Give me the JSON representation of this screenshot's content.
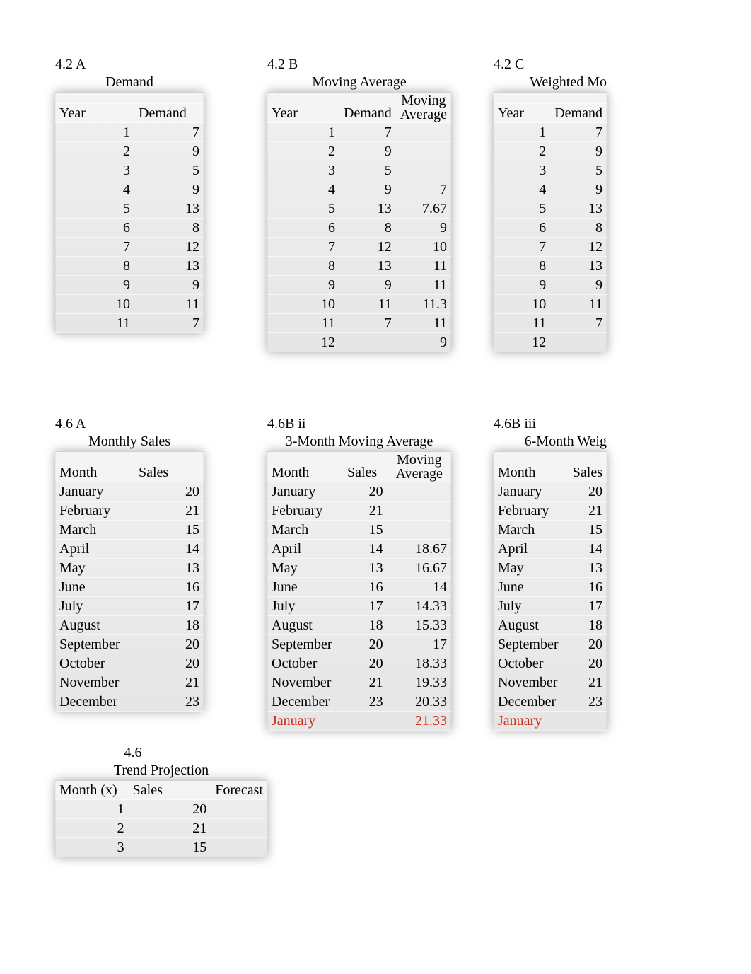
{
  "table42A": {
    "heading": "4.2 A",
    "title": "Demand",
    "cols": [
      "Year",
      "Demand"
    ],
    "rows": [
      {
        "year": "1",
        "demand": "7"
      },
      {
        "year": "2",
        "demand": "9"
      },
      {
        "year": "3",
        "demand": "5"
      },
      {
        "year": "4",
        "demand": "9"
      },
      {
        "year": "5",
        "demand": "13"
      },
      {
        "year": "6",
        "demand": "8"
      },
      {
        "year": "7",
        "demand": "12"
      },
      {
        "year": "8",
        "demand": "13"
      },
      {
        "year": "9",
        "demand": "9"
      },
      {
        "year": "10",
        "demand": "11"
      },
      {
        "year": "11",
        "demand": "7"
      }
    ]
  },
  "table42B": {
    "heading": "4.2 B",
    "title": "Moving Average",
    "cols": [
      "Year",
      "Demand",
      "Moving Average"
    ],
    "rows": [
      {
        "year": "1",
        "demand": "7",
        "ma": ""
      },
      {
        "year": "2",
        "demand": "9",
        "ma": ""
      },
      {
        "year": "3",
        "demand": "5",
        "ma": ""
      },
      {
        "year": "4",
        "demand": "9",
        "ma": "7"
      },
      {
        "year": "5",
        "demand": "13",
        "ma": "7.67"
      },
      {
        "year": "6",
        "demand": "8",
        "ma": "9"
      },
      {
        "year": "7",
        "demand": "12",
        "ma": "10"
      },
      {
        "year": "8",
        "demand": "13",
        "ma": "11"
      },
      {
        "year": "9",
        "demand": "9",
        "ma": "11"
      },
      {
        "year": "10",
        "demand": "11",
        "ma": "11.3"
      },
      {
        "year": "11",
        "demand": "7",
        "ma": "11"
      },
      {
        "year": "12",
        "demand": "",
        "ma": "9"
      }
    ]
  },
  "table42C": {
    "heading": "4.2 C",
    "title": "Weighted Mo",
    "cols": [
      "Year",
      "Demand"
    ],
    "rows": [
      {
        "year": "1",
        "demand": "7"
      },
      {
        "year": "2",
        "demand": "9"
      },
      {
        "year": "3",
        "demand": "5"
      },
      {
        "year": "4",
        "demand": "9"
      },
      {
        "year": "5",
        "demand": "13"
      },
      {
        "year": "6",
        "demand": "8"
      },
      {
        "year": "7",
        "demand": "12"
      },
      {
        "year": "8",
        "demand": "13"
      },
      {
        "year": "9",
        "demand": "9"
      },
      {
        "year": "10",
        "demand": "11"
      },
      {
        "year": "11",
        "demand": "7"
      },
      {
        "year": "12",
        "demand": ""
      }
    ]
  },
  "table46A": {
    "heading": "4.6 A",
    "title": "Monthly Sales",
    "cols": [
      "Month",
      "Sales"
    ],
    "rows": [
      {
        "month": "January",
        "sales": "20"
      },
      {
        "month": "February",
        "sales": "21"
      },
      {
        "month": "March",
        "sales": "15"
      },
      {
        "month": "April",
        "sales": "14"
      },
      {
        "month": "May",
        "sales": "13"
      },
      {
        "month": "June",
        "sales": "16"
      },
      {
        "month": "July",
        "sales": "17"
      },
      {
        "month": "August",
        "sales": "18"
      },
      {
        "month": "September",
        "sales": "20"
      },
      {
        "month": "October",
        "sales": "20"
      },
      {
        "month": "November",
        "sales": "21"
      },
      {
        "month": "December",
        "sales": "23"
      }
    ]
  },
  "table46Bii": {
    "heading": "4.6B ii",
    "title": "3-Month Moving Average",
    "cols": [
      "Month",
      "Sales",
      "Moving Average"
    ],
    "rows": [
      {
        "month": "January",
        "sales": "20",
        "ma": "",
        "red": false
      },
      {
        "month": "February",
        "sales": "21",
        "ma": "",
        "red": false
      },
      {
        "month": "March",
        "sales": "15",
        "ma": "",
        "red": false
      },
      {
        "month": "April",
        "sales": "14",
        "ma": "18.67",
        "red": false
      },
      {
        "month": "May",
        "sales": "13",
        "ma": "16.67",
        "red": false
      },
      {
        "month": "June",
        "sales": "16",
        "ma": "14",
        "red": false
      },
      {
        "month": "July",
        "sales": "17",
        "ma": "14.33",
        "red": false
      },
      {
        "month": "August",
        "sales": "18",
        "ma": "15.33",
        "red": false
      },
      {
        "month": "September",
        "sales": "20",
        "ma": "17",
        "red": false
      },
      {
        "month": "October",
        "sales": "20",
        "ma": "18.33",
        "red": false
      },
      {
        "month": "November",
        "sales": "21",
        "ma": "19.33",
        "red": false
      },
      {
        "month": "December",
        "sales": "23",
        "ma": "20.33",
        "red": false
      },
      {
        "month": "January",
        "sales": "",
        "ma": "21.33",
        "red": true
      }
    ]
  },
  "table46Biii": {
    "heading": "4.6B iii",
    "title": "6-Month Weig",
    "cols": [
      "Month",
      "Sales"
    ],
    "rows": [
      {
        "month": "January",
        "sales": "20",
        "red": false
      },
      {
        "month": "February",
        "sales": "21",
        "red": false
      },
      {
        "month": "March",
        "sales": "15",
        "red": false
      },
      {
        "month": "April",
        "sales": "14",
        "red": false
      },
      {
        "month": "May",
        "sales": "13",
        "red": false
      },
      {
        "month": "June",
        "sales": "16",
        "red": false
      },
      {
        "month": "July",
        "sales": "17",
        "red": false
      },
      {
        "month": "August",
        "sales": "18",
        "red": false
      },
      {
        "month": "September",
        "sales": "20",
        "red": false
      },
      {
        "month": "October",
        "sales": "20",
        "red": false
      },
      {
        "month": "November",
        "sales": "21",
        "red": false
      },
      {
        "month": "December",
        "sales": "23",
        "red": false
      },
      {
        "month": "January",
        "sales": "",
        "red": true
      }
    ]
  },
  "table46Trend": {
    "heading": "4.6",
    "title": "Trend Projection",
    "cols": [
      "Month (x)",
      "Sales",
      "Forecast"
    ],
    "rows": [
      {
        "x": "1",
        "sales": "20",
        "fc": ""
      },
      {
        "x": "2",
        "sales": "21",
        "fc": ""
      },
      {
        "x": "3",
        "sales": "15",
        "fc": ""
      }
    ]
  }
}
